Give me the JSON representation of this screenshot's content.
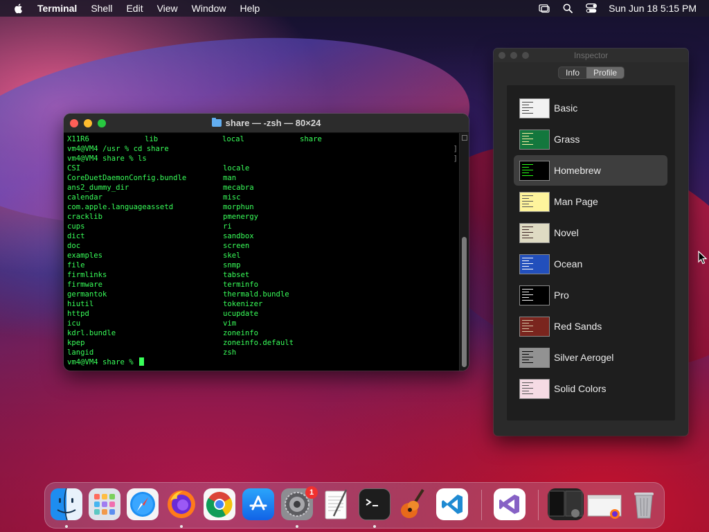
{
  "menubar": {
    "app_name": "Terminal",
    "items": [
      "Shell",
      "Edit",
      "View",
      "Window",
      "Help"
    ],
    "clock": "Sun Jun 18  5:15 PM"
  },
  "terminal": {
    "title": "share — -zsh — 80×24",
    "first_row": [
      "X11R6",
      "lib",
      "local",
      "share"
    ],
    "prompt_lines": [
      "vm4@VM4 /usr % cd share",
      "vm4@VM4 share % ls"
    ],
    "ls_left": [
      "CSI",
      "CoreDuetDaemonConfig.bundle",
      "ans2_dummy_dir",
      "calendar",
      "com.apple.languageassetd",
      "cracklib",
      "cups",
      "dict",
      "doc",
      "examples",
      "file",
      "firmlinks",
      "firmware",
      "germantok",
      "hiutil",
      "httpd",
      "icu",
      "kdrl.bundle",
      "kpep",
      "langid"
    ],
    "ls_right": [
      "locale",
      "man",
      "mecabra",
      "misc",
      "morphun",
      "pmenergy",
      "ri",
      "sandbox",
      "screen",
      "skel",
      "snmp",
      "tabset",
      "terminfo",
      "thermald.bundle",
      "tokenizer",
      "ucupdate",
      "vim",
      "zoneinfo",
      "zoneinfo.default",
      "zsh"
    ],
    "current_prompt": "vm4@VM4 share % ",
    "text_color": "#39ff5a"
  },
  "inspector": {
    "title": "Inspector",
    "tabs": [
      "Info",
      "Profile"
    ],
    "active_tab": "Profile",
    "selected_profile": "Homebrew",
    "profiles": [
      {
        "name": "Basic",
        "bg": "#f2f2f2",
        "fg": "#444444"
      },
      {
        "name": "Grass",
        "bg": "#13773d",
        "fg": "#fff0a5"
      },
      {
        "name": "Homebrew",
        "bg": "#000000",
        "fg": "#28fe14"
      },
      {
        "name": "Man Page",
        "bg": "#fef49c",
        "fg": "#555555"
      },
      {
        "name": "Novel",
        "bg": "#dfdbc3",
        "fg": "#3b2322"
      },
      {
        "name": "Ocean",
        "bg": "#224fbc",
        "fg": "#ffffff"
      },
      {
        "name": "Pro",
        "bg": "#000000",
        "fg": "#f2f2f2"
      },
      {
        "name": "Red Sands",
        "bg": "#7a251e",
        "fg": "#d7c9a7"
      },
      {
        "name": "Silver Aerogel",
        "bg": "#929292",
        "fg": "#000000"
      },
      {
        "name": "Solid Colors",
        "bg": "#f5dbe4",
        "fg": "#555555"
      }
    ]
  },
  "dock": {
    "apps": [
      {
        "name": "Finder",
        "icon": "finder-icon",
        "running": true
      },
      {
        "name": "Launchpad",
        "icon": "launchpad-icon",
        "running": false
      },
      {
        "name": "Safari",
        "icon": "safari-icon",
        "running": false
      },
      {
        "name": "Firefox",
        "icon": "firefox-icon",
        "running": true
      },
      {
        "name": "Chrome",
        "icon": "chrome-icon",
        "running": false
      },
      {
        "name": "App Store",
        "icon": "app-store-icon",
        "running": false
      },
      {
        "name": "System Preferences",
        "icon": "system-preferences-icon",
        "running": true,
        "badge": "1"
      },
      {
        "name": "TextEdit",
        "icon": "textedit-icon",
        "running": false
      },
      {
        "name": "Terminal",
        "icon": "terminal-icon",
        "running": true
      },
      {
        "name": "GarageBand",
        "icon": "garageband-icon",
        "running": false
      },
      {
        "name": "Visual Studio Code",
        "icon": "vscode-icon",
        "running": false
      },
      {
        "name": "Visual Studio",
        "icon": "visual-studio-icon",
        "running": false
      }
    ]
  }
}
